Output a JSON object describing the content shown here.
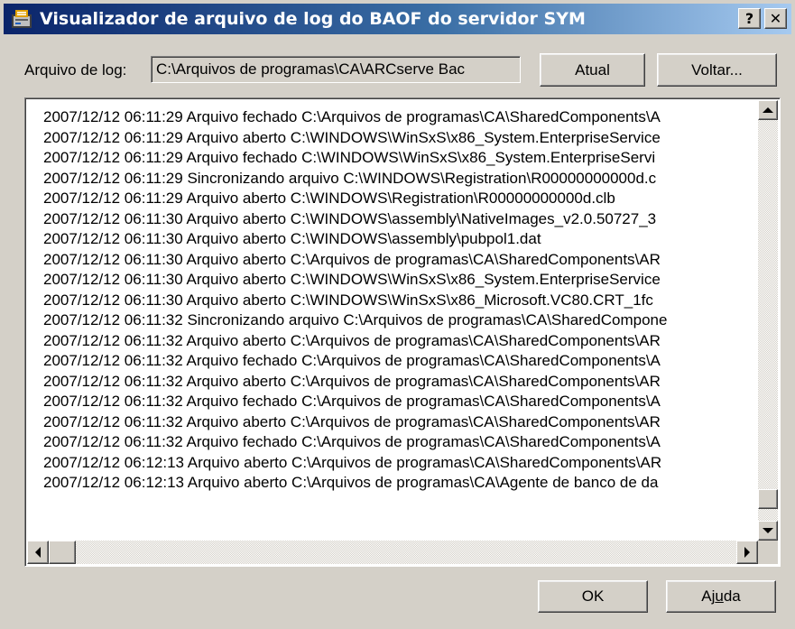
{
  "window": {
    "title": "Visualizador de arquivo de log do BAOF do servidor SYM",
    "help_label": "?",
    "close_label": "✕"
  },
  "logfile": {
    "label": "Arquivo de log:",
    "path": "C:\\Arquivos de programas\\CA\\ARCserve Bac"
  },
  "buttons": {
    "refresh": "Atual",
    "back": "Voltar...",
    "ok": "OK",
    "help_prefix": "Aj",
    "help_underline": "u",
    "help_suffix": "da"
  },
  "log_lines": [
    "2007/12/12 06:11:29 Arquivo fechado C:\\Arquivos de programas\\CA\\SharedComponents\\A",
    "2007/12/12 06:11:29 Arquivo aberto C:\\WINDOWS\\WinSxS\\x86_System.EnterpriseService",
    "2007/12/12 06:11:29 Arquivo fechado C:\\WINDOWS\\WinSxS\\x86_System.EnterpriseServi",
    "2007/12/12 06:11:29 Sincronizando arquivo C:\\WINDOWS\\Registration\\R00000000000d.c",
    "2007/12/12 06:11:29 Arquivo aberto C:\\WINDOWS\\Registration\\R00000000000d.clb",
    "2007/12/12 06:11:30 Arquivo aberto C:\\WINDOWS\\assembly\\NativeImages_v2.0.50727_3",
    "2007/12/12 06:11:30 Arquivo aberto C:\\WINDOWS\\assembly\\pubpol1.dat",
    "2007/12/12 06:11:30 Arquivo aberto C:\\Arquivos de programas\\CA\\SharedComponents\\AR",
    "2007/12/12 06:11:30 Arquivo aberto C:\\WINDOWS\\WinSxS\\x86_System.EnterpriseService",
    "2007/12/12 06:11:30 Arquivo aberto C:\\WINDOWS\\WinSxS\\x86_Microsoft.VC80.CRT_1fc",
    "2007/12/12 06:11:32 Sincronizando arquivo C:\\Arquivos de programas\\CA\\SharedCompone",
    "2007/12/12 06:11:32 Arquivo aberto C:\\Arquivos de programas\\CA\\SharedComponents\\AR",
    "2007/12/12 06:11:32 Arquivo fechado C:\\Arquivos de programas\\CA\\SharedComponents\\A",
    "2007/12/12 06:11:32 Arquivo aberto C:\\Arquivos de programas\\CA\\SharedComponents\\AR",
    "2007/12/12 06:11:32 Arquivo fechado C:\\Arquivos de programas\\CA\\SharedComponents\\A",
    "2007/12/12 06:11:32 Arquivo aberto C:\\Arquivos de programas\\CA\\SharedComponents\\AR",
    "2007/12/12 06:11:32 Arquivo fechado C:\\Arquivos de programas\\CA\\SharedComponents\\A",
    "2007/12/12 06:12:13 Arquivo aberto C:\\Arquivos de programas\\CA\\SharedComponents\\AR",
    "2007/12/12 06:12:13 Arquivo aberto C:\\Arquivos de programas\\CA\\Agente de banco de da"
  ],
  "scroll": {
    "vertical_position": 0.97,
    "horizontal_position": 0.0
  },
  "icons": {
    "app": "log-viewer-app-icon",
    "help": "help-icon",
    "close": "close-icon"
  },
  "colors": {
    "title_gradient_start": "#0a246a",
    "title_gradient_end": "#a6caf0",
    "dialog_face": "#d4d0c8"
  }
}
